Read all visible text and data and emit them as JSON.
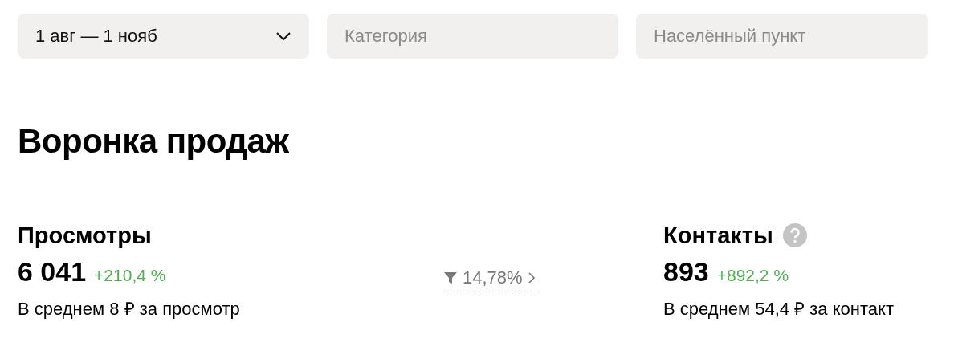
{
  "filters": [
    {
      "kind": "dropdown",
      "value": "1 авг — 1 нояб"
    },
    {
      "kind": "field",
      "placeholder": "Категория"
    },
    {
      "kind": "field",
      "placeholder": "Населённый пункт"
    }
  ],
  "title": "Воронка продаж",
  "metrics": [
    {
      "kind": "metric",
      "label": "Просмотры",
      "help": false,
      "value": "6 041",
      "change": "+210,4 %",
      "note": "В среднем 8 ₽ за просмотр"
    },
    {
      "kind": "conversion",
      "value": "14,78%"
    },
    {
      "kind": "metric",
      "label": "Контакты",
      "help": true,
      "value": "893",
      "change": "+892,2 %",
      "note": "В среднем 54,4 ₽ за контакт"
    }
  ]
}
